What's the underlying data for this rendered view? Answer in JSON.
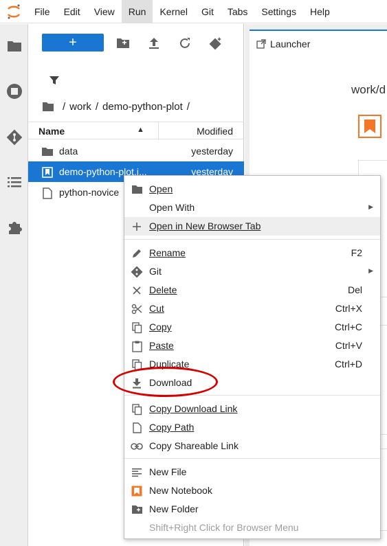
{
  "menubar": {
    "items": [
      "File",
      "Edit",
      "View",
      "Run",
      "Kernel",
      "Git",
      "Tabs",
      "Settings",
      "Help"
    ],
    "active": "Run"
  },
  "filebrowser": {
    "new_button_label": "+",
    "breadcrumb": [
      "work",
      "demo-python-plot"
    ],
    "columns": {
      "name": "Name",
      "modified": "Modified"
    },
    "files": [
      {
        "name": "data",
        "modified": "yesterday",
        "icon": "folder-icon"
      },
      {
        "name": "demo-python-plot.i...",
        "modified": "yesterday",
        "icon": "notebook-icon",
        "selected": true
      },
      {
        "name": "python-novice",
        "modified": "",
        "icon": "file-icon"
      }
    ]
  },
  "main": {
    "tab_label": "Launcher",
    "launcher_path": "work/d"
  },
  "context_menu": {
    "items": [
      {
        "label": "Open",
        "underline": "O",
        "shortcut": "",
        "icon": "folder-icon"
      },
      {
        "label": "Open With",
        "shortcut": "",
        "icon": "",
        "submenu": true
      },
      {
        "label": "Open in New Browser Tab",
        "underline": "O",
        "shortcut": "",
        "icon": "plus-icon"
      },
      {
        "label": "Rename",
        "underline": "R",
        "shortcut": "F2",
        "icon": "pencil-icon"
      },
      {
        "label": "Git",
        "shortcut": "",
        "icon": "git-icon",
        "submenu": true
      },
      {
        "label": "Delete",
        "underline": "D",
        "shortcut": "Del",
        "icon": "close-icon"
      },
      {
        "label": "Cut",
        "underline": "C",
        "shortcut": "Ctrl+X",
        "icon": "scissors-icon"
      },
      {
        "label": "Copy",
        "underline": "C",
        "shortcut": "Ctrl+C",
        "icon": "copy-icon"
      },
      {
        "label": "Paste",
        "underline": "P",
        "shortcut": "Ctrl+V",
        "icon": "paste-icon"
      },
      {
        "label": "Duplicate",
        "underline": "D",
        "shortcut": "Ctrl+D",
        "icon": "duplicate-icon"
      },
      {
        "label": "Download",
        "shortcut": "",
        "icon": "download-icon"
      },
      {
        "label": "Copy Download Link",
        "underline": "C",
        "shortcut": "",
        "icon": "copy-icon"
      },
      {
        "label": "Copy Path",
        "underline": "C",
        "shortcut": "",
        "icon": "file-icon"
      },
      {
        "label": "Copy Shareable Link",
        "shortcut": "",
        "icon": "link-icon"
      },
      {
        "label": "New File",
        "shortcut": "",
        "icon": "text-file-icon"
      },
      {
        "label": "New Notebook",
        "shortcut": "",
        "icon": "notebook-icon"
      },
      {
        "label": "New Folder",
        "shortcut": "",
        "icon": "new-folder-icon"
      },
      {
        "label": "Shift+Right Click for Browser Menu",
        "shortcut": "",
        "icon": "",
        "disabled": true
      }
    ]
  },
  "colors": {
    "accent": "#1976d2",
    "notebook_orange": "#f37726",
    "annotation_red": "#d50000",
    "icon_gray": "#616161"
  }
}
